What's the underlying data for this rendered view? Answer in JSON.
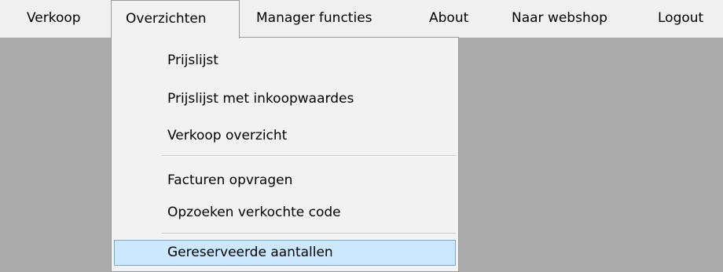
{
  "menubar": {
    "items": [
      {
        "label": "Verkoop"
      },
      {
        "label": "Overzichten"
      },
      {
        "label": "Manager functies"
      },
      {
        "label": "About"
      },
      {
        "label": "Naar webshop"
      },
      {
        "label": "Logout"
      }
    ]
  },
  "dropdown": {
    "items": [
      {
        "label": "Prijslijst"
      },
      {
        "label": "Prijslijst met inkoopwaardes"
      },
      {
        "label": "Verkoop overzicht"
      },
      {
        "label": "Facturen opvragen"
      },
      {
        "label": "Opzoeken verkochte code"
      },
      {
        "label": "Gereserveerde aantallen"
      }
    ]
  },
  "colors": {
    "menubar_bg": "#f0f0f0",
    "workspace_bg": "#ababab",
    "highlight_bg": "#cce8ff",
    "highlight_border": "#7aa9d9"
  }
}
